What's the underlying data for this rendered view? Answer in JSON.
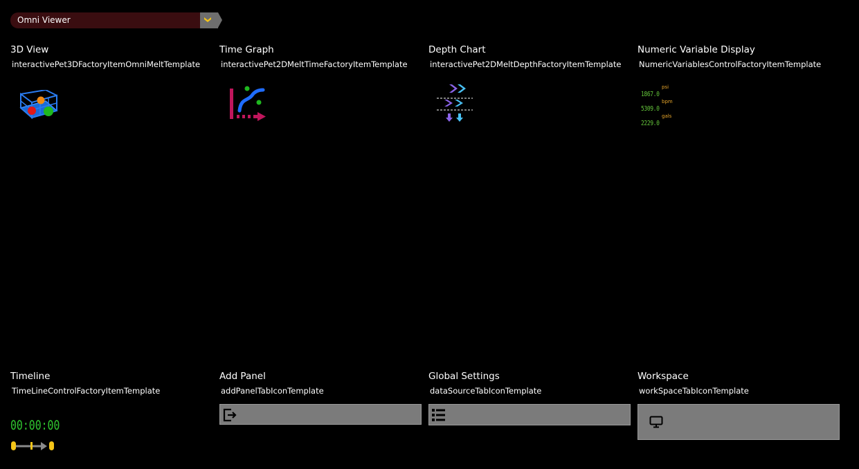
{
  "selector": {
    "value": "Omni Viewer"
  },
  "items": [
    {
      "title": "3D View",
      "template": "interactivePet3DFactoryItemOmniMeltTemplate",
      "icon": "3d-cube-icon"
    },
    {
      "title": "Time Graph",
      "template": "interactivePet2DMeltTimeFactoryItemTemplate",
      "icon": "time-graph-icon"
    },
    {
      "title": "Depth Chart",
      "template": "interactivePet2DMeltDepthFactoryItemTemplate",
      "icon": "depth-chart-icon"
    },
    {
      "title": "Numeric Variable Display",
      "template": "NumericVariablesControlFactoryItemTemplate",
      "icon": "numeric-values-icon"
    },
    {
      "title": "Timeline",
      "template": "TimeLineControlFactoryItemTemplate",
      "icon": "timeline-icon"
    },
    {
      "title": "Add Panel",
      "template": "addPanelTabIconTemplate",
      "icon": "add-panel-icon"
    },
    {
      "title": "Global Settings",
      "template": "dataSourceTabIconTemplate",
      "icon": "list-icon"
    },
    {
      "title": "Workspace",
      "template": "workSpaceTabIconTemplate",
      "icon": "monitor-icon"
    }
  ],
  "numeric_values": [
    {
      "value": "1867.0",
      "unit": "psi"
    },
    {
      "value": "5309.0",
      "unit": "bpm"
    },
    {
      "value": "2229.0",
      "unit": "gals"
    }
  ],
  "timeline": {
    "clock": "00:00:00"
  },
  "colors": {
    "background": "#000000",
    "selector_field": "#3a0d10",
    "selector_button": "#6e6e6e",
    "chevron": "#f5c518",
    "numeric_value": "#63c33a",
    "numeric_unit": "#e8a62a",
    "clock": "#2fc42f",
    "placeholder_bar": "#7b7b7b"
  }
}
